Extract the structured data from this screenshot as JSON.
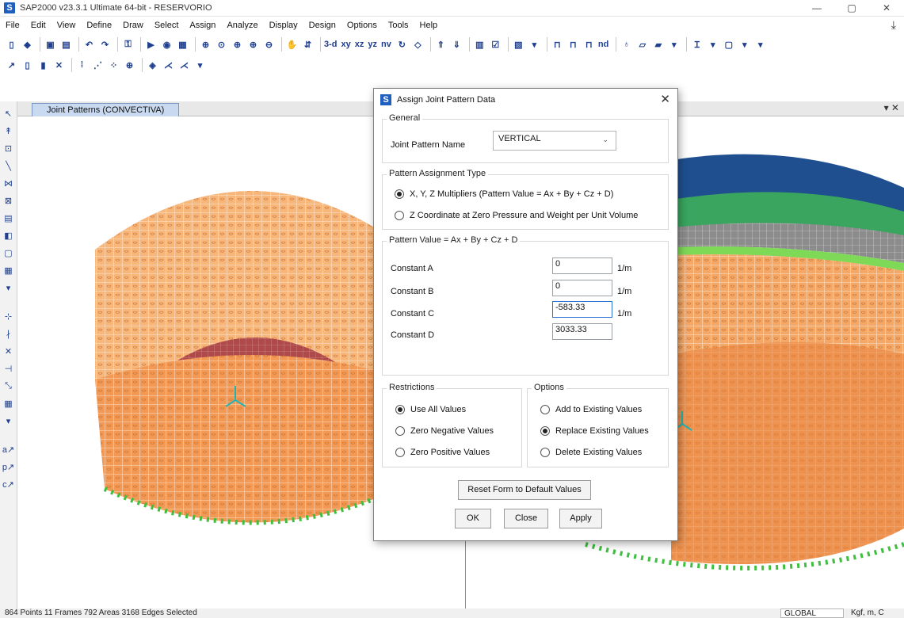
{
  "window": {
    "title": "SAP2000 v23.3.1 Ultimate 64-bit - RESERVORIO",
    "app_icon": "S",
    "minimize": "—",
    "maximize": "▢",
    "close": "✕"
  },
  "menu": {
    "items": [
      "File",
      "Edit",
      "View",
      "Define",
      "Draw",
      "Select",
      "Assign",
      "Analyze",
      "Display",
      "Design",
      "Options",
      "Tools",
      "Help"
    ],
    "download_icon": "⤓"
  },
  "toolbar": {
    "view_buttons": [
      "3-d",
      "xy",
      "xz",
      "yz",
      "nv"
    ],
    "nd_label": "nd"
  },
  "viewport": {
    "tab_label": "Joint Patterns (CONVECTIVA)",
    "close_glyph": "▾ ✕"
  },
  "dialog": {
    "title": "Assign Joint Pattern Data",
    "icon": "S",
    "close": "✕",
    "general": {
      "label": "General",
      "pattern_name_label": "Joint Pattern Name",
      "pattern_name_value": "VERTICAL"
    },
    "assignment_type": {
      "label": "Pattern Assignment Type",
      "options": [
        {
          "label": "X, Y, Z Multipliers  (Pattern Value = Ax + By + Cz + D)",
          "selected": true
        },
        {
          "label": "Z Coordinate at Zero Pressure and Weight per Unit Volume",
          "selected": false
        }
      ]
    },
    "pattern_value": {
      "label": "Pattern Value = Ax + By + Cz + D",
      "constants": [
        {
          "label": "Constant A",
          "value": "0",
          "unit": "1/m"
        },
        {
          "label": "Constant B",
          "value": "0",
          "unit": "1/m"
        },
        {
          "label": "Constant C",
          "value": "-583.33",
          "unit": "1/m"
        },
        {
          "label": "Constant D",
          "value": "3033.33",
          "unit": ""
        }
      ]
    },
    "restrictions": {
      "label": "Restrictions",
      "options": [
        {
          "label": "Use All Values",
          "selected": true
        },
        {
          "label": "Zero Negative Values",
          "selected": false
        },
        {
          "label": "Zero Positive Values",
          "selected": false
        }
      ]
    },
    "options": {
      "label": "Options",
      "options": [
        {
          "label": "Add to Existing Values",
          "selected": false
        },
        {
          "label": "Replace Existing Values",
          "selected": true
        },
        {
          "label": "Delete Existing Values",
          "selected": false
        }
      ]
    },
    "buttons": {
      "reset": "Reset Form to Default Values",
      "ok": "OK",
      "close": "Close",
      "apply": "Apply"
    }
  },
  "status": {
    "selection": "864 Points  11 Frames  792 Areas  3168 Edges Selected",
    "coord_system": "GLOBAL",
    "units": "Kgf, m, C"
  },
  "colors": {
    "tank_orange": "#f4a868",
    "tank_orange_dark": "#e8803a",
    "mesh_line": "#ffffff",
    "dome_red": "#b04a4a",
    "roof_blue": "#1f4f8f",
    "roof_green": "#3cae5a",
    "band_green": "#7ed957",
    "support_green": "#3fbf3f",
    "accent_blue": "#1f5fbf"
  }
}
